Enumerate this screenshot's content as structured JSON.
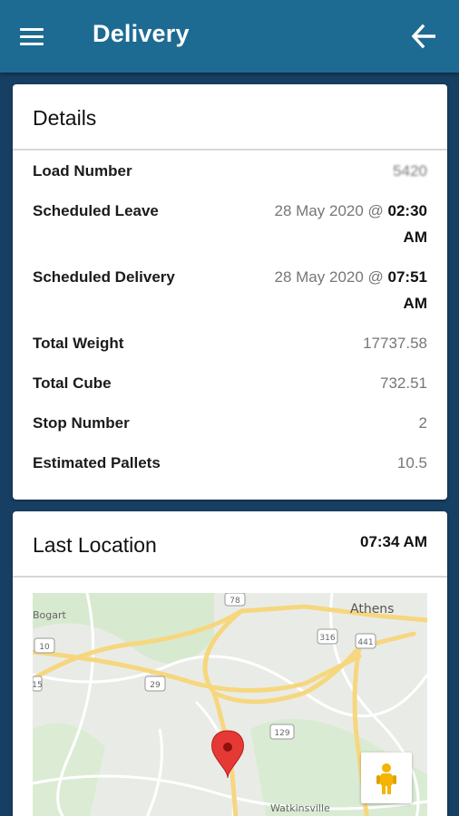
{
  "appbar": {
    "title": "Delivery",
    "menu_icon": "hamburger-menu-icon",
    "back_icon": "arrow-left-icon",
    "color": "#1d6b92"
  },
  "details": {
    "title": "Details",
    "rows": [
      {
        "label": "Load Number",
        "value": "5420"
      },
      {
        "label": "Scheduled Leave",
        "value_date": "28 May 2020 @ ",
        "value_time": "02:30",
        "value_ampm": "AM"
      },
      {
        "label": "Scheduled Delivery",
        "value_date": "28 May 2020 @ ",
        "value_time": "07:51",
        "value_ampm": "AM"
      },
      {
        "label": "Total Weight",
        "value": "17737.58"
      },
      {
        "label": "Total Cube",
        "value": "732.51"
      },
      {
        "label": "Stop Number",
        "value": "2"
      },
      {
        "label": "Estimated Pallets",
        "value": "10.5"
      }
    ]
  },
  "location": {
    "title": "Last Location",
    "time": "07:34 AM",
    "map": {
      "labels": [
        "Athens",
        "Bogart",
        "Watkinsville"
      ],
      "route_badges": [
        "78",
        "10",
        "29",
        "316",
        "441",
        "129",
        "15"
      ],
      "marker_icon": "map-pin-icon",
      "pegman_icon": "street-view-pegman-icon",
      "marker_color": "#e53935"
    }
  }
}
